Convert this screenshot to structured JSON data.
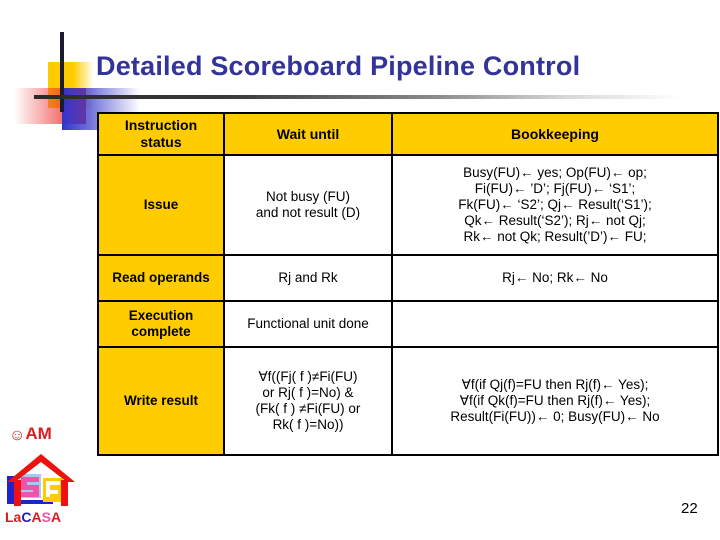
{
  "slide": {
    "title": "Detailed Scoreboard Pipeline Control",
    "page_number": "22",
    "title_color": "#333399",
    "accent_color": "#FFCC00"
  },
  "table": {
    "headers": {
      "stage": "Instruction status",
      "wait": "Wait until",
      "bookkeeping": "Bookkeeping"
    },
    "rows": [
      {
        "stage": "Issue",
        "wait": "Not busy (FU)\nand not result (D)",
        "bookkeeping": "Busy(FU)← yes; Op(FU)← op;\nFi(FU)← ’D’; Fj(FU)← ‘S1’;\nFk(FU)← ‘S2’; Qj← Result(‘S1’);\nQk←  Result(‘S2’);  Rj← not Qj;\nRk← not Qk; Result(’D’)← FU;"
      },
      {
        "stage": "Read operands",
        "wait": "Rj and Rk",
        "bookkeeping": "Rj← No; Rk← No"
      },
      {
        "stage": "Execution complete",
        "wait": "Functional unit done",
        "bookkeeping": ""
      },
      {
        "stage": "Write result",
        "wait": "∀f((Fj( f )≠Fi(FU)\nor Rj( f )=No) &\n(Fk( f ) ≠Fi(FU) or\nRk( f )=No))",
        "bookkeeping": "∀f(if Qj(f)=FU then Rj(f)← Yes);\n∀f(if Qk(f)=FU then Rj(f)← Yes);\nResult(Fi(FU))← 0; Busy(FU)← No"
      }
    ]
  },
  "brand": {
    "am_smiley": "☺",
    "am_text": "AM",
    "lacasa": {
      "la": "La",
      "c": "C",
      "a1": "A",
      "s": "S",
      "a2": "A"
    }
  }
}
